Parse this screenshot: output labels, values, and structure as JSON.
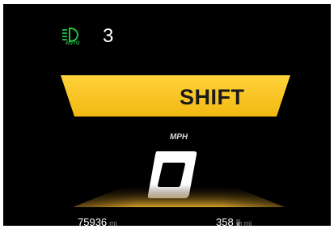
{
  "status_bar": {
    "headlamp_icon": "auto-headlamp-icon",
    "headlamp_mode": "AUTO",
    "gear": "3"
  },
  "alert": {
    "label": "SHIFT"
  },
  "speed": {
    "unit": "MPH",
    "value": "0"
  },
  "trip": {
    "odometer": "75936",
    "odometer_unit": "mi",
    "range": "358",
    "fuel_icon": "fuel-pump-icon",
    "range_unit": "mi"
  },
  "colors": {
    "banner": "#ffd23a",
    "indicator_green": "#1fc24a",
    "screen_background": "#000000"
  }
}
